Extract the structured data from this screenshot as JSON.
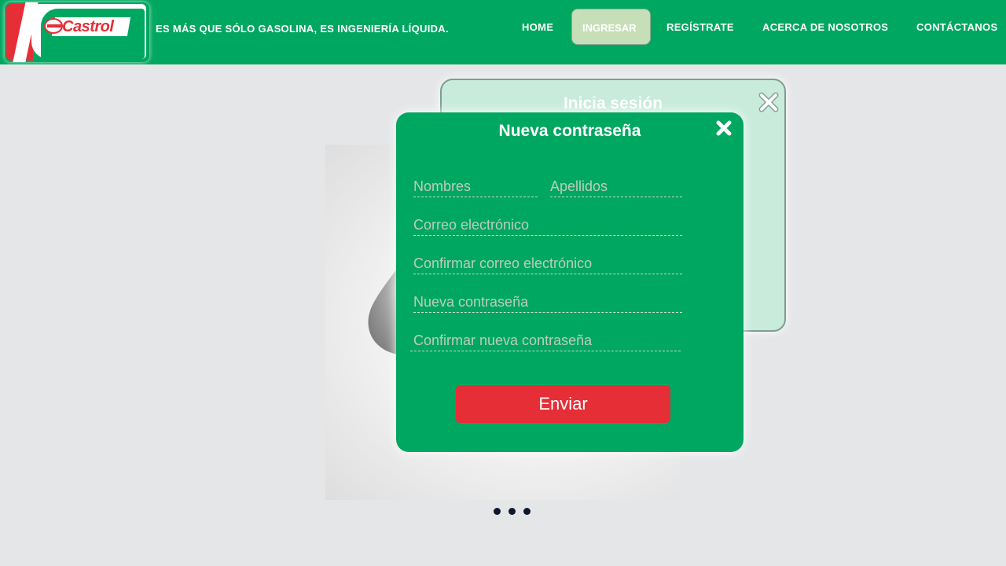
{
  "header": {
    "logo_text": "Castrol",
    "tagline": "ES MÁS QUE SÓLO GASOLINA, ES INGENIERÍA LÍQUIDA.",
    "nav": [
      {
        "label": "HOME"
      },
      {
        "label": "INGRESAR",
        "active": true
      },
      {
        "label": "REGÍSTRATE"
      },
      {
        "label": "ACERCA DE NOSOTROS"
      },
      {
        "label": "CONTÁCTANOS"
      }
    ]
  },
  "login_modal": {
    "title": "Inicia sesión"
  },
  "reset_modal": {
    "title": "Nueva contraseña",
    "fields": {
      "first_name": {
        "placeholder": "Nombres",
        "value": ""
      },
      "last_name": {
        "placeholder": "Apellidos",
        "value": ""
      },
      "email": {
        "placeholder": "Correo electrónico",
        "value": ""
      },
      "confirm_email": {
        "placeholder": "Confirmar correo electrónico",
        "value": ""
      },
      "new_password": {
        "placeholder": "Nueva contraseña",
        "value": ""
      },
      "confirm_password": {
        "placeholder": "Confirmar nueva contraseña",
        "value": ""
      }
    },
    "submit_label": "Enviar"
  },
  "carousel": {
    "slide_count": 3,
    "current_slide": 1
  },
  "colors": {
    "brand_green": "#00a760",
    "brand_red": "#e62e37",
    "active_nav_bg": "#c6dfb8",
    "page_bg": "#e5e6e8",
    "back_modal_bg": "#c8ebdc",
    "dot": "#0e1830"
  }
}
